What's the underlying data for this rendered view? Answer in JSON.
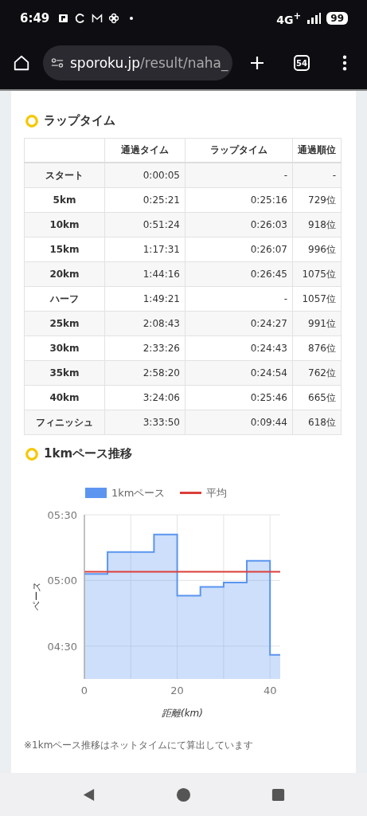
{
  "status_bar": {
    "time": "6:49",
    "network": "4G$^{+}$",
    "battery": "99"
  },
  "browser": {
    "url_host": "sporoku.jp",
    "url_path": "/result/naha_",
    "tab_count": "54"
  },
  "lap_section": {
    "title": "ラップタイム",
    "columns": [
      "通過タイム",
      "ラップタイム",
      "通過順位"
    ],
    "rows": [
      {
        "point": "スタート",
        "split": "0:00:05",
        "lap": "-",
        "rank": "-"
      },
      {
        "point": "5km",
        "split": "0:25:21",
        "lap": "0:25:16",
        "rank": "729位"
      },
      {
        "point": "10km",
        "split": "0:51:24",
        "lap": "0:26:03",
        "rank": "918位"
      },
      {
        "point": "15km",
        "split": "1:17:31",
        "lap": "0:26:07",
        "rank": "996位"
      },
      {
        "point": "20km",
        "split": "1:44:16",
        "lap": "0:26:45",
        "rank": "1075位"
      },
      {
        "point": "ハーフ",
        "split": "1:49:21",
        "lap": "-",
        "rank": "1057位"
      },
      {
        "point": "25km",
        "split": "2:08:43",
        "lap": "0:24:27",
        "rank": "991位"
      },
      {
        "point": "30km",
        "split": "2:33:26",
        "lap": "0:24:43",
        "rank": "876位"
      },
      {
        "point": "35km",
        "split": "2:58:20",
        "lap": "0:24:54",
        "rank": "762位"
      },
      {
        "point": "40km",
        "split": "3:24:06",
        "lap": "0:25:46",
        "rank": "665位"
      },
      {
        "point": "フィニッシュ",
        "split": "3:33:50",
        "lap": "0:09:44",
        "rank": "618位"
      }
    ]
  },
  "pace_section": {
    "title": "1kmペース推移",
    "chart_data": {
      "type": "area",
      "xlabel": "距離(km)",
      "ylabel": "ペース",
      "x": [
        0,
        5,
        5,
        10,
        10,
        15,
        15,
        20,
        20,
        25,
        25,
        30,
        30,
        35,
        35,
        40,
        40,
        42.2
      ],
      "series": [
        {
          "name": "1kmペース",
          "type": "area",
          "color": "#5b95f0",
          "values": [
            303,
            303,
            313,
            313,
            313,
            313,
            321,
            321,
            293,
            293,
            297,
            297,
            299,
            299,
            309,
            309,
            266,
            266
          ]
        },
        {
          "name": "平均",
          "type": "line",
          "color": "#dc3e3a",
          "values": [
            304,
            304,
            304,
            304,
            304,
            304,
            304,
            304,
            304,
            304,
            304,
            304,
            304,
            304,
            304,
            304,
            304,
            304
          ]
        }
      ],
      "grid": true,
      "legend": "top",
      "xlim": [
        0,
        42.2
      ],
      "ylim": [
        255,
        330
      ],
      "xticks": [
        0,
        20,
        40
      ],
      "yticks": [
        {
          "value": 330,
          "label": "05:30"
        },
        {
          "value": 300,
          "label": "05:00"
        },
        {
          "value": 270,
          "label": "04:30"
        }
      ]
    },
    "note": "※1kmペース推移はネットタイムにて算出しています"
  }
}
